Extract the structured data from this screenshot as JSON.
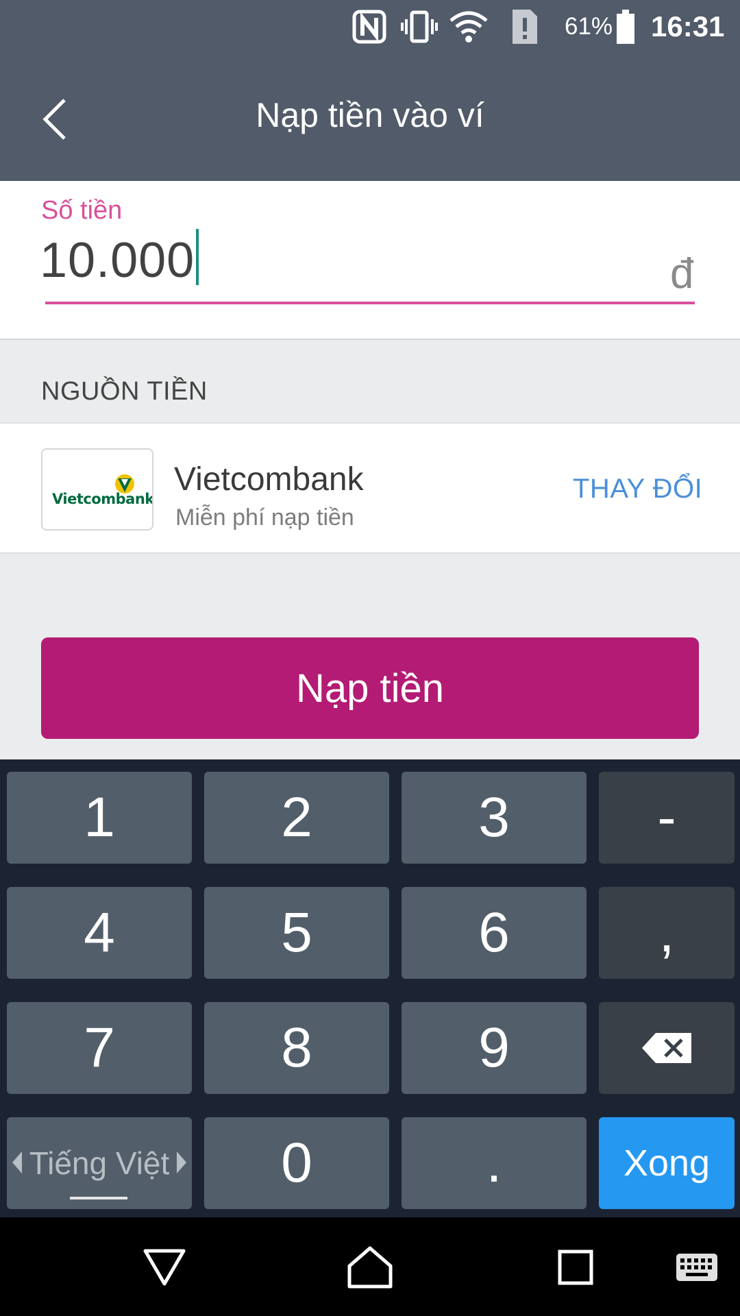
{
  "status_bar": {
    "battery_percent": "61%",
    "time": "16:31",
    "icons": [
      "nfc-icon",
      "vibrate-icon",
      "wifi-icon",
      "sim-alert-icon",
      "battery-icon"
    ]
  },
  "app_bar": {
    "title": "Nạp tiền vào ví",
    "back_icon": "chevron-left-icon"
  },
  "amount": {
    "label": "Số tiền",
    "value": "10.000",
    "currency": "đ"
  },
  "source": {
    "header": "NGUỒN TIỀN",
    "bank_logo_text": "Vietcombank",
    "bank_name": "Vietcombank",
    "bank_subtitle": "Miễn phí nạp tiền",
    "change_label": "THAY ĐỔI"
  },
  "submit": {
    "label": "Nạp tiền"
  },
  "keyboard": {
    "keys": [
      "1",
      "2",
      "3",
      "-",
      "4",
      "5",
      "6",
      ",",
      "7",
      "8",
      "9",
      "0",
      "."
    ],
    "language": "Tiếng Việt",
    "done_label": "Xong",
    "backspace_icon": "backspace-icon"
  },
  "nav_bar": {
    "icons": [
      "back-triangle-icon",
      "home-icon",
      "recents-icon",
      "keyboard-icon"
    ]
  },
  "colors": {
    "app_bar": "#515b69",
    "accent_pink": "#d8509a",
    "primary_button": "#b31b74",
    "link_blue": "#4a8fd8",
    "keyboard_bg": "#1c2433",
    "key_bg": "#525f6a",
    "key_dark": "#3a4048",
    "done_key": "#2598f2"
  }
}
